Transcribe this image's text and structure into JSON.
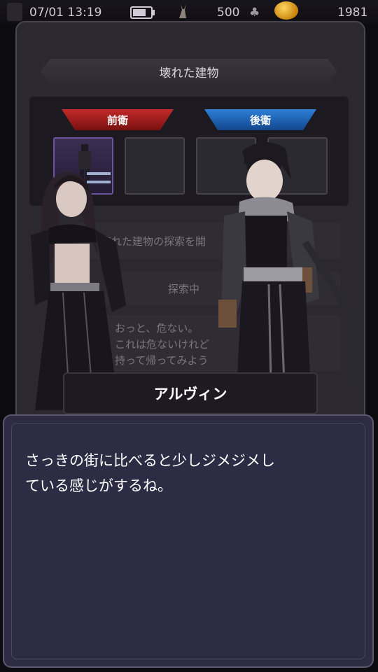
{
  "status_bar": {
    "datetime": "07/01 13:19",
    "stamina": "500",
    "coins": "1981",
    "battery_level": 0.75
  },
  "location": {
    "title": "壊れた建物"
  },
  "party": {
    "front_label": "前衛",
    "back_label": "後衛"
  },
  "log": {
    "line1": "壊れた建物の探索を開",
    "line2": "探索中",
    "message_lines": [
      "おっと、危ない。",
      "これは危ないけれど",
      "持って帰ってみよう"
    ]
  },
  "dialogue": {
    "speaker": "アルヴィン",
    "text_line1": "さっきの街に比べると少しジメジメし",
    "text_line2": "ている感じがするね。"
  },
  "colors": {
    "front_tag": "#c22a2a",
    "back_tag": "#2d7fd6",
    "dialog_bg": "#2e2b44"
  }
}
